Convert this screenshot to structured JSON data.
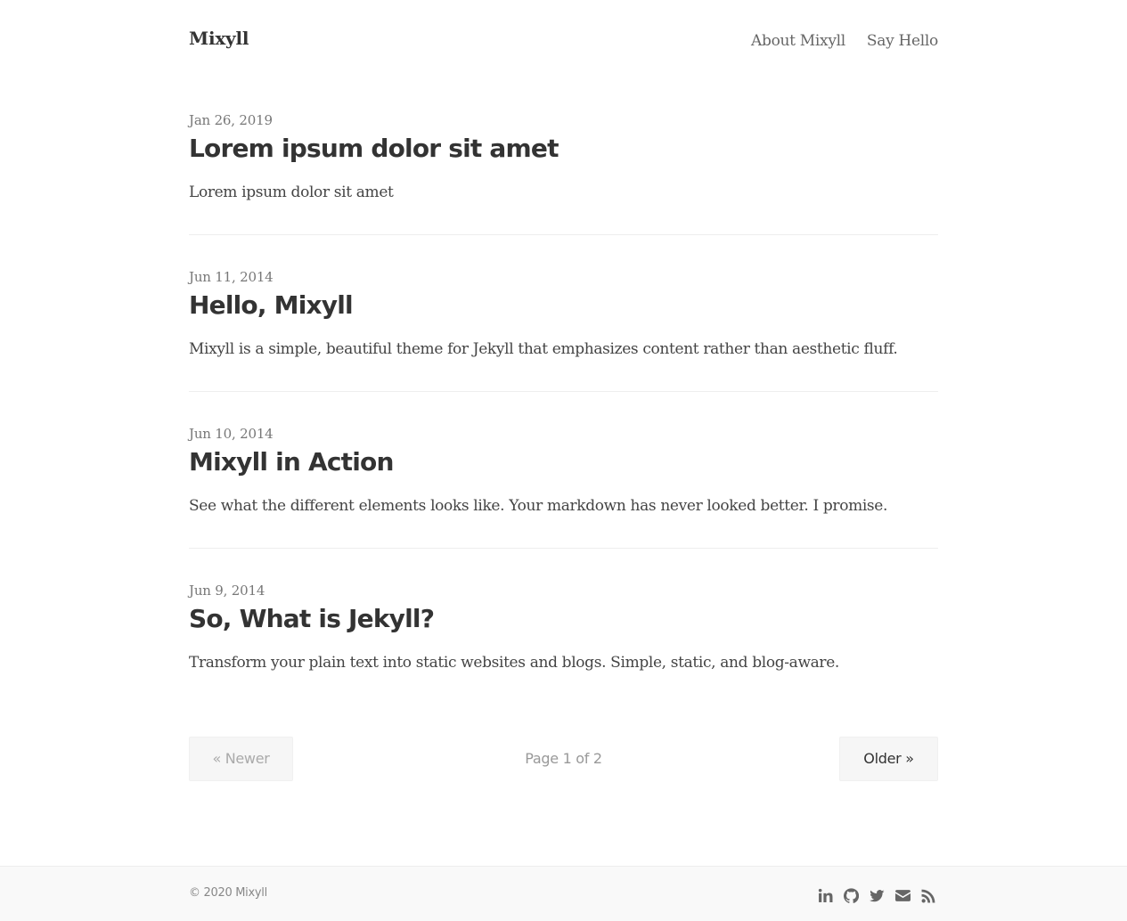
{
  "header": {
    "site_title": "Mixyll",
    "nav": [
      {
        "label": "About Mixyll"
      },
      {
        "label": "Say Hello"
      }
    ]
  },
  "posts": [
    {
      "date": "Jan 26, 2019",
      "title": "Lorem ipsum dolor sit amet",
      "excerpt": "Lorem ipsum dolor sit amet"
    },
    {
      "date": "Jun 11, 2014",
      "title": "Hello, Mixyll",
      "excerpt": "Mixyll is a simple, beautiful theme for Jekyll that emphasizes content rather than aesthetic fluff."
    },
    {
      "date": "Jun 10, 2014",
      "title": "Mixyll in Action",
      "excerpt": "See what the different elements looks like. Your markdown has never looked better. I promise."
    },
    {
      "date": "Jun 9, 2014",
      "title": "So, What is Jekyll?",
      "excerpt": "Transform your plain text into static websites and blogs. Simple, static, and blog-aware."
    }
  ],
  "pagination": {
    "newer_label": "« Newer",
    "page_label": "Page 1 of 2",
    "older_label": "Older »"
  },
  "footer": {
    "copyright": "© 2020 Mixyll",
    "social_icons": [
      "linkedin-icon",
      "github-icon",
      "twitter-icon",
      "envelope-icon",
      "rss-icon"
    ]
  },
  "colors": {
    "text": "#333333",
    "muted": "#777777",
    "border": "#eeeeee",
    "footer_bg": "#f9f9f9",
    "button_bg": "#f6f6f6"
  }
}
